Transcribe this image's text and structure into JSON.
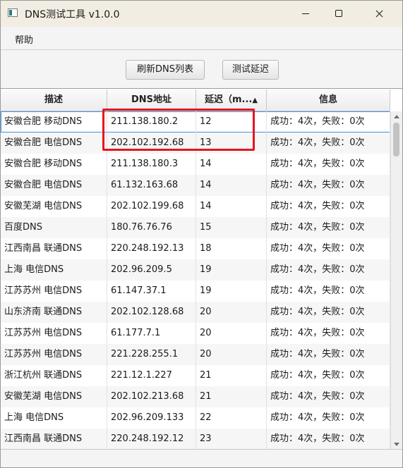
{
  "window": {
    "title": "DNS测试工具 v1.0.0"
  },
  "menu": {
    "help": "帮助"
  },
  "toolbar": {
    "refresh_label": "刷新DNS列表",
    "test_label": "测试延迟"
  },
  "table": {
    "columns": [
      "描述",
      "DNS地址",
      "延迟（m...",
      "信息"
    ],
    "sort_indicator": "▲",
    "rows": [
      {
        "desc": "安徽合肥 移动DNS",
        "addr": "211.138.180.2",
        "latency": "12",
        "info": "成功：4次，失败：0次"
      },
      {
        "desc": "安徽合肥 电信DNS",
        "addr": "202.102.192.68",
        "latency": "13",
        "info": "成功：4次，失败：0次"
      },
      {
        "desc": "安徽合肥 移动DNS",
        "addr": "211.138.180.3",
        "latency": "14",
        "info": "成功：4次，失败：0次"
      },
      {
        "desc": "安徽合肥 电信DNS",
        "addr": "61.132.163.68",
        "latency": "14",
        "info": "成功：4次，失败：0次"
      },
      {
        "desc": "安徽芜湖 电信DNS",
        "addr": "202.102.199.68",
        "latency": "14",
        "info": "成功：4次，失败：0次"
      },
      {
        "desc": "百度DNS",
        "addr": "180.76.76.76",
        "latency": "15",
        "info": "成功：4次，失败：0次"
      },
      {
        "desc": "江西南昌 联通DNS",
        "addr": "220.248.192.13",
        "latency": "18",
        "info": "成功：4次，失败：0次"
      },
      {
        "desc": "上海 电信DNS",
        "addr": "202.96.209.5",
        "latency": "19",
        "info": "成功：4次，失败：0次"
      },
      {
        "desc": "江苏苏州 电信DNS",
        "addr": "61.147.37.1",
        "latency": "19",
        "info": "成功：4次，失败：0次"
      },
      {
        "desc": "山东济南 联通DNS",
        "addr": "202.102.128.68",
        "latency": "20",
        "info": "成功：4次，失败：0次"
      },
      {
        "desc": "江苏苏州 电信DNS",
        "addr": "61.177.7.1",
        "latency": "20",
        "info": "成功：4次，失败：0次"
      },
      {
        "desc": "江苏苏州 电信DNS",
        "addr": "221.228.255.1",
        "latency": "20",
        "info": "成功：4次，失败：0次"
      },
      {
        "desc": "浙江杭州 联通DNS",
        "addr": "221.12.1.227",
        "latency": "21",
        "info": "成功：4次，失败：0次"
      },
      {
        "desc": "安徽芜湖 电信DNS",
        "addr": "202.102.213.68",
        "latency": "21",
        "info": "成功：4次，失败：0次"
      },
      {
        "desc": "上海 电信DNS",
        "addr": "202.96.209.133",
        "latency": "22",
        "info": "成功：4次，失败：0次"
      },
      {
        "desc": "江西南昌 联通DNS",
        "addr": "220.248.192.12",
        "latency": "23",
        "info": "成功：4次，失败：0次"
      }
    ]
  },
  "colors": {
    "highlight": "#e8141e",
    "focus": "#4a8fd8"
  }
}
